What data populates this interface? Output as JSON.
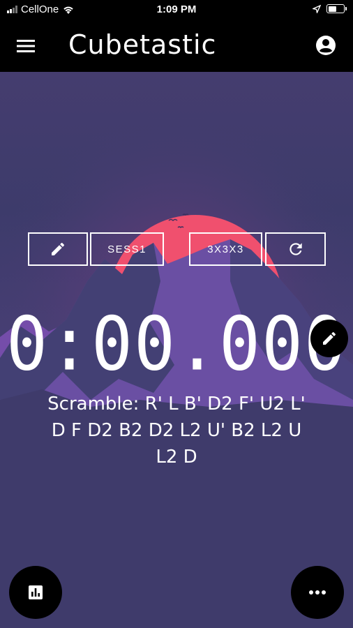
{
  "status_bar": {
    "carrier": "CellOne",
    "time": "1:09 PM",
    "battery_level": 0.55,
    "icons": [
      "signal-icon",
      "wifi-icon",
      "location-arrow-icon",
      "battery-icon"
    ]
  },
  "app_bar": {
    "title": "Cubetastic",
    "icons": [
      "menu-icon",
      "account-circle-icon"
    ]
  },
  "controls": {
    "edit_icon": "pencil-icon",
    "session_label": "SESS1",
    "puzzle_label": "3X3X3",
    "refresh_icon": "refresh-icon"
  },
  "timer": {
    "value": "0:00.000"
  },
  "scramble": {
    "text": "Scramble: R' L B' D2 F' U2 L' D F D2 B2 D2 L2 U' B2 L2 U L2 D"
  },
  "fabs": {
    "edit_icon": "pencil-icon",
    "stats_icon": "bar-chart-icon",
    "more_icon": "more-horizontal-icon"
  },
  "colors": {
    "background": "#3f3a6c",
    "sun": "#f0506e",
    "mountain": "#6a4fa3",
    "accent_text": "#ffffff"
  }
}
